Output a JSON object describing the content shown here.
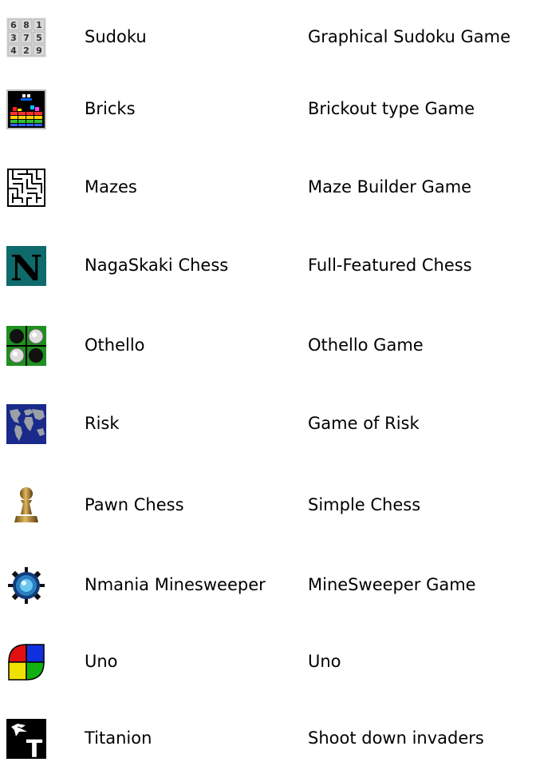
{
  "games": [
    {
      "name": "Sudoku",
      "description": "Graphical Sudoku Game",
      "icon": "sudoku-icon",
      "sudoku_digits": [
        "6",
        "8",
        "1",
        "3",
        "7",
        "5",
        "4",
        "2",
        "9"
      ]
    },
    {
      "name": "Bricks",
      "description": "Brickout type Game",
      "icon": "bricks-icon"
    },
    {
      "name": "Mazes",
      "description": "Maze Builder Game",
      "icon": "maze-icon"
    },
    {
      "name": "NagaSkaki Chess",
      "description": "Full-Featured Chess",
      "icon": "nagaskaki-n-icon",
      "icon_letter": "N"
    },
    {
      "name": "Othello",
      "description": "Othello Game",
      "icon": "othello-icon"
    },
    {
      "name": "Risk",
      "description": "Game of Risk",
      "icon": "world-map-icon"
    },
    {
      "name": "Pawn Chess",
      "description": "Simple Chess",
      "icon": "pawn-icon"
    },
    {
      "name": "Nmania Minesweeper",
      "description": "MineSweeper Game",
      "icon": "mine-icon"
    },
    {
      "name": "Uno",
      "description": "Uno",
      "icon": "uno-icon"
    },
    {
      "name": "Titanion",
      "description": "Shoot down invaders",
      "icon": "titanion-icon",
      "icon_letter": "T"
    }
  ],
  "colors": {
    "nagaskaki_bg": "#0f6b6b",
    "othello_green": "#1f8f1f",
    "risk_blue": "#1a2a8a",
    "uno_red": "#e01010",
    "uno_blue": "#1030e0",
    "uno_yellow": "#f0e000",
    "uno_green": "#10b010"
  }
}
